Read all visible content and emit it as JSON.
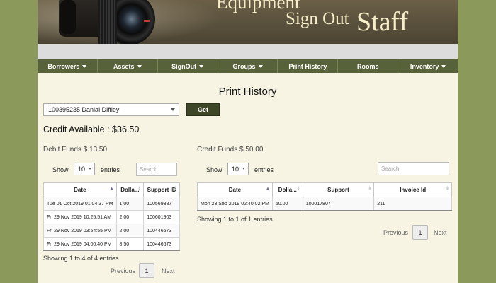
{
  "banner": {
    "title_line1": "Equipment",
    "title_line2": "Sign Out",
    "title_line3": "Staff"
  },
  "nav": {
    "items": [
      {
        "label": "Borrowers"
      },
      {
        "label": "Assets"
      },
      {
        "label": "SignOut"
      },
      {
        "label": "Groups"
      },
      {
        "label": "Print History"
      },
      {
        "label": "Rooms"
      },
      {
        "label": "Inventory"
      }
    ]
  },
  "page": {
    "title": "Print History",
    "user_select_value": "100395235 Danial Diffley",
    "get_label": "Get",
    "credit": "Credit Available : $36.50"
  },
  "debit": {
    "title": "Debit Funds $ 13.50",
    "show_label": "Show",
    "length_value": "10",
    "entries_label": "entries",
    "search_placeholder": "Search",
    "columns": [
      "Date",
      "Dolla...",
      "Support ID"
    ],
    "rows": [
      [
        "Tue 01 Oct 2019 01:04:37 PM",
        "1.00",
        "100569387"
      ],
      [
        "Fri 29 Nov 2019 10:25:51 AM",
        "2.00",
        "100601903"
      ],
      [
        "Fri 29 Nov 2019 03:54:55 PM",
        "2.00",
        "100446673"
      ],
      [
        "Fri 29 Nov 2019 04:00:40 PM",
        "8.50",
        "100446673"
      ]
    ],
    "info": "Showing 1 to 4 of 4 entries",
    "prev": "Previous",
    "page": "1",
    "next": "Next"
  },
  "credit_funds": {
    "title": "Credit Funds $ 50.00",
    "show_label": "Show",
    "length_value": "10",
    "entries_label": "entries",
    "search_placeholder": "Search",
    "columns": [
      "Date",
      "Dolla...",
      "Support",
      "Invoice Id"
    ],
    "rows": [
      [
        "Mon 23 Sep 2019 02:40:02 PM",
        "50.00",
        "100017807",
        "211"
      ]
    ],
    "info": "Showing 1 to 1 of 1 entries",
    "prev": "Previous",
    "page": "1",
    "next": "Next"
  },
  "colors": {
    "background": "#8b9a5b",
    "nav": "#58623a",
    "button": "#3d4626",
    "page": "#f7f4e4"
  }
}
